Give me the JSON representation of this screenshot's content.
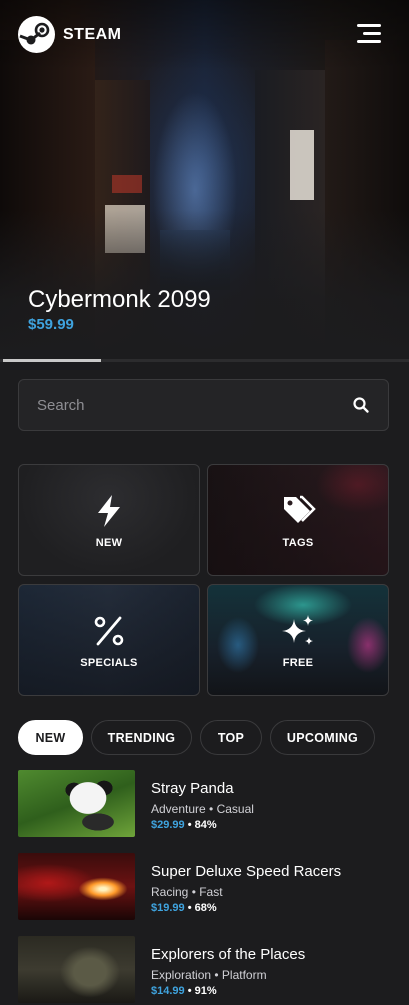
{
  "app": {
    "name": "STEAM"
  },
  "featured": {
    "title": "Cybermonk 2099",
    "price": "$59.99",
    "carousel_progress": 0.24
  },
  "search": {
    "placeholder": "Search"
  },
  "categories": [
    {
      "label": "NEW",
      "icon": "lightning-icon"
    },
    {
      "label": "TAGS",
      "icon": "tags-icon"
    },
    {
      "label": "SPECIALS",
      "icon": "percent-icon"
    },
    {
      "label": "FREE",
      "icon": "sparkle-icon"
    }
  ],
  "filters": [
    {
      "label": "NEW",
      "active": true
    },
    {
      "label": "TRENDING",
      "active": false
    },
    {
      "label": "TOP",
      "active": false
    },
    {
      "label": "UPCOMING",
      "active": false
    }
  ],
  "games": [
    {
      "title": "Stray Panda",
      "genres": "Adventure • Casual",
      "price": "$29.99",
      "separator": "•",
      "score": "84%"
    },
    {
      "title": "Super Deluxe Speed Racers",
      "genres": "Racing • Fast",
      "price": "$19.99",
      "separator": "•",
      "score": "68%"
    },
    {
      "title": "Explorers of the Places",
      "genres": "Exploration • Platform",
      "price": "$14.99",
      "separator": "•",
      "score": "91%"
    }
  ],
  "colors": {
    "background": "#1c1c1e",
    "accent_price": "#3fa3de",
    "pill_active": "#ffffff"
  }
}
